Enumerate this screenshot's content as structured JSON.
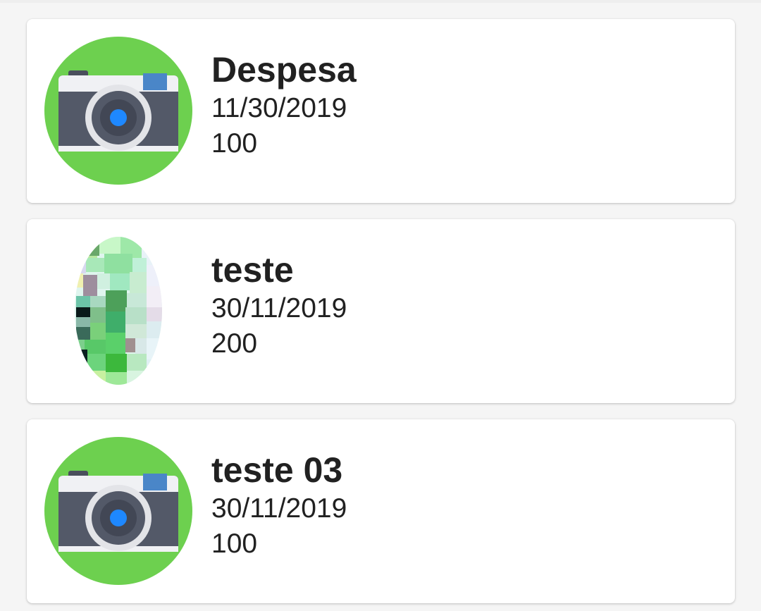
{
  "accent_color": "#6dd04f",
  "expenses": [
    {
      "title": "Despesa",
      "date": "11/30/2019",
      "amount": "100",
      "image": "camera-icon"
    },
    {
      "title": "teste",
      "date": "30/11/2019",
      "amount": "200",
      "image": "receipt-photo"
    },
    {
      "title": "teste 03",
      "date": "30/11/2019",
      "amount": "100",
      "image": "camera-icon"
    }
  ]
}
